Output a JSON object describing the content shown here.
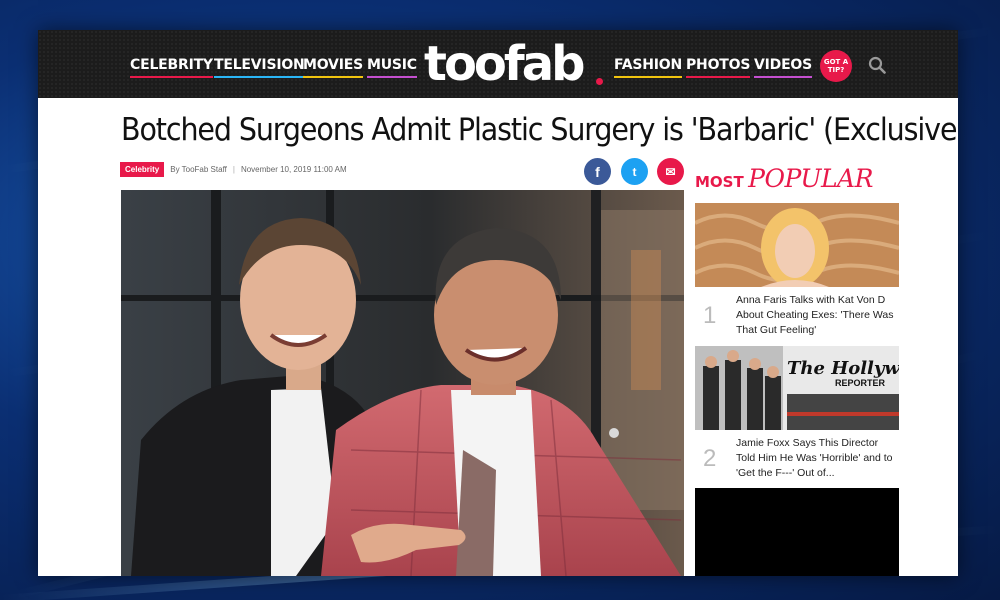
{
  "nav": {
    "left_items": [
      {
        "label": "CELEBRITY",
        "underline": "#e8194a"
      },
      {
        "label": "TELEVISION",
        "underline": "#2ab5f5"
      },
      {
        "label": "MOVIES",
        "underline": "#f1c40f"
      },
      {
        "label": "MUSIC",
        "underline": "#c44fd0"
      }
    ],
    "logo": "toofab",
    "right_items": [
      {
        "label": "FASHION",
        "underline": "#f1c40f"
      },
      {
        "label": "PHOTOS",
        "underline": "#e8194a"
      },
      {
        "label": "VIDEOS",
        "underline": "#c44fd0"
      }
    ],
    "tip_line1": "GOT A",
    "tip_line2": "TIP?",
    "search_icon": "search-icon"
  },
  "article": {
    "headline": "Botched Surgeons Admit Plastic Surgery is 'Barbaric' (Exclusive)",
    "category": "Celebrity",
    "byline": "By TooFab Staff",
    "date": "November 10, 2019 11:00 AM",
    "share": {
      "facebook": "f",
      "twitter": "t",
      "email": "✉"
    }
  },
  "sidebar": {
    "heading_bold": "MOST",
    "heading_italic": "POPULAR",
    "items": [
      {
        "rank": "1",
        "title": "Anna Faris Talks with Kat Von D About Cheating Exes: 'There Was That Gut Feeling'"
      },
      {
        "rank": "2",
        "title": "Jamie Foxx Says This Director Told Him He Was 'Horrible' and to 'Get the F---' Out of..."
      }
    ],
    "magazine_masthead": "The Hollywood",
    "magazine_sub": "REPORTER"
  },
  "colors": {
    "accent": "#e8194a",
    "nav_bg": "#1c1c1c"
  }
}
